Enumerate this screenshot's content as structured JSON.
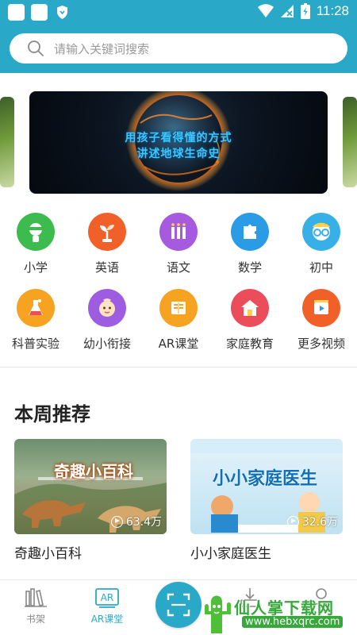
{
  "status_bar": {
    "time": "11:28"
  },
  "search": {
    "placeholder": "请输入关键词搜索"
  },
  "banner": {
    "line1": "用孩子看得懂的方式",
    "line2": "讲述地球生命史"
  },
  "categories": [
    {
      "label": "小学",
      "icon": "primary-school-icon",
      "color": "#3dbb4e"
    },
    {
      "label": "英语",
      "icon": "sprout-icon",
      "color": "#f2602a"
    },
    {
      "label": "语文",
      "icon": "chinese-books-icon",
      "color": "#a55adf"
    },
    {
      "label": "数学",
      "icon": "puzzle-icon",
      "color": "#2a9ce6"
    },
    {
      "label": "初中",
      "icon": "glasses-student-icon",
      "color": "#37b0e8"
    },
    {
      "label": "科普实验",
      "icon": "flask-icon",
      "color": "#f5a321"
    },
    {
      "label": "幼小衔接",
      "icon": "baby-face-icon",
      "color": "#9e5ce0"
    },
    {
      "label": "AR课堂",
      "icon": "ar-book-icon",
      "color": "#f5a321"
    },
    {
      "label": "家庭教育",
      "icon": "home-icon",
      "color": "#ec4d5b"
    },
    {
      "label": "更多视频",
      "icon": "video-icon",
      "color": "#f2602a"
    }
  ],
  "section": {
    "title": "本周推荐"
  },
  "cards": [
    {
      "title": "奇趣小百科",
      "thumb_title": "奇趣小百科",
      "views": "63.4万"
    },
    {
      "title": "小小家庭医生",
      "thumb_title": "小小家庭医生",
      "views": "32.6万"
    }
  ],
  "bottom_nav": {
    "bookshelf": "书架",
    "ar_class": "AR课堂",
    "accent_color": "#2aa8c8"
  },
  "watermark": {
    "brand": "仙人掌下载网",
    "url": "www.hebxqrc.com"
  }
}
